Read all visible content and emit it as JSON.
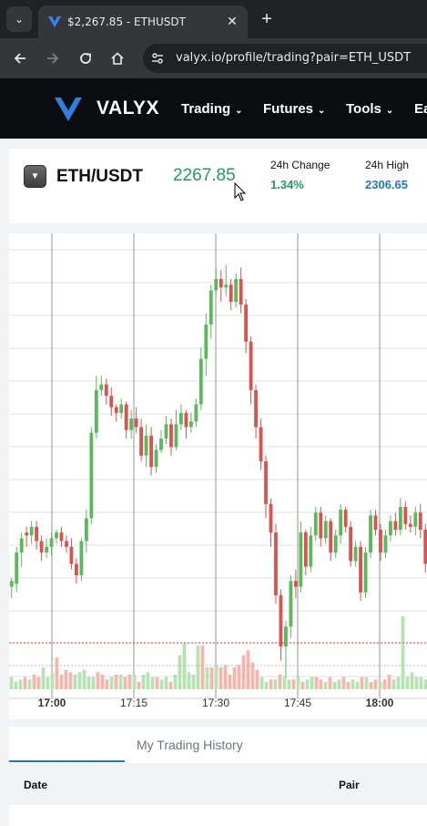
{
  "browser": {
    "tab_title": "$2,267.85 - ETHUSDT",
    "tab_close": "✕",
    "new_tab": "+",
    "tab_menu": "⌄",
    "url": "valyx.io/profile/trading?pair=ETH_USDT"
  },
  "header": {
    "brand": "VALYX",
    "nav": [
      {
        "label": "Trading"
      },
      {
        "label": "Futures"
      },
      {
        "label": "Tools"
      },
      {
        "label": "Ea"
      }
    ]
  },
  "ticker": {
    "pair": "ETH/USDT",
    "last_price": "2267.85",
    "change_label": "24h Change",
    "change_value": "1.34%",
    "high_label": "24h High",
    "high_value": "2306.65"
  },
  "colors": {
    "up": "#5cb85c",
    "down": "#d9534f",
    "up_volume": "#b7e3b4",
    "down_volume": "#f4b7ad",
    "price_green": "#1f9e5e",
    "high_blue": "#1e78c8"
  },
  "chart_data": {
    "type": "candlestick",
    "x_tick_labels": [
      "17:00",
      "17:15",
      "17:30",
      "17:45",
      "18:00"
    ],
    "candles": [
      [
        76,
        78,
        72,
        79
      ],
      [
        77,
        88,
        74,
        90
      ],
      [
        88,
        93,
        83,
        95
      ],
      [
        95,
        94,
        90,
        97
      ],
      [
        94,
        97,
        91,
        99
      ],
      [
        97,
        92,
        89,
        99
      ],
      [
        92,
        88,
        85,
        94
      ],
      [
        88,
        90,
        86,
        93
      ],
      [
        90,
        93,
        87,
        95
      ],
      [
        93,
        95,
        91,
        96
      ],
      [
        95,
        92,
        90,
        97
      ],
      [
        92,
        90,
        88,
        94
      ],
      [
        90,
        84,
        82,
        93
      ],
      [
        84,
        80,
        77,
        86
      ],
      [
        80,
        92,
        78,
        93
      ],
      [
        92,
        100,
        88,
        103
      ],
      [
        100,
        130,
        98,
        132
      ],
      [
        130,
        145,
        128,
        150
      ],
      [
        145,
        147,
        143,
        150
      ],
      [
        147,
        143,
        140,
        149
      ],
      [
        143,
        139,
        136,
        146
      ],
      [
        139,
        137,
        134,
        140
      ],
      [
        137,
        140,
        135,
        142
      ],
      [
        140,
        131,
        128,
        141
      ],
      [
        131,
        135,
        128,
        138
      ],
      [
        135,
        132,
        130,
        139
      ],
      [
        132,
        122,
        120,
        135
      ],
      [
        122,
        129,
        118,
        133
      ],
      [
        129,
        118,
        115,
        132
      ],
      [
        118,
        124,
        116,
        126
      ],
      [
        124,
        128,
        123,
        131
      ],
      [
        128,
        133,
        126,
        136
      ],
      [
        133,
        125,
        122,
        135
      ],
      [
        125,
        133,
        124,
        138
      ],
      [
        133,
        137,
        131,
        140
      ],
      [
        137,
        132,
        128,
        138
      ],
      [
        132,
        134,
        130,
        137
      ],
      [
        134,
        140,
        132,
        142
      ],
      [
        140,
        156,
        138,
        160
      ],
      [
        156,
        168,
        150,
        172
      ],
      [
        168,
        180,
        163,
        182
      ],
      [
        180,
        184,
        178,
        188
      ],
      [
        184,
        181,
        176,
        187
      ],
      [
        181,
        182,
        178,
        189
      ],
      [
        182,
        176,
        173,
        184
      ],
      [
        176,
        184,
        174,
        186
      ],
      [
        184,
        175,
        172,
        188
      ],
      [
        175,
        162,
        158,
        177
      ],
      [
        162,
        145,
        140,
        164
      ],
      [
        145,
        132,
        128,
        147
      ],
      [
        132,
        120,
        117,
        135
      ],
      [
        120,
        105,
        100,
        122
      ],
      [
        105,
        95,
        90,
        107
      ],
      [
        95,
        73,
        70,
        98
      ],
      [
        73,
        55,
        50,
        75
      ],
      [
        55,
        62,
        44,
        64
      ],
      [
        62,
        78,
        58,
        80
      ],
      [
        78,
        76,
        72,
        82
      ],
      [
        76,
        95,
        74,
        99
      ],
      [
        95,
        83,
        80,
        96
      ],
      [
        83,
        94,
        81,
        97
      ],
      [
        94,
        102,
        92,
        104
      ],
      [
        102,
        93,
        90,
        104
      ],
      [
        93,
        99,
        91,
        101
      ],
      [
        99,
        88,
        85,
        100
      ],
      [
        88,
        94,
        86,
        96
      ],
      [
        94,
        103,
        91,
        105
      ],
      [
        103,
        97,
        95,
        104
      ],
      [
        97,
        85,
        83,
        99
      ],
      [
        85,
        90,
        83,
        92
      ],
      [
        90,
        74,
        71,
        92
      ],
      [
        74,
        88,
        72,
        90
      ],
      [
        88,
        101,
        86,
        103
      ],
      [
        101,
        96,
        94,
        103
      ],
      [
        96,
        88,
        85,
        98
      ],
      [
        88,
        94,
        86,
        96
      ],
      [
        94,
        99,
        92,
        101
      ],
      [
        99,
        96,
        94,
        102
      ],
      [
        96,
        104,
        94,
        107
      ],
      [
        104,
        98,
        96,
        106
      ],
      [
        98,
        97,
        95,
        101
      ],
      [
        97,
        102,
        94,
        104
      ],
      [
        102,
        96,
        93,
        105
      ],
      [
        96,
        84,
        81,
        98
      ]
    ],
    "volume": [
      5,
      3,
      4,
      5,
      4,
      6,
      5,
      9,
      5,
      7,
      13,
      6,
      8,
      7,
      6,
      7,
      8,
      5,
      5,
      7,
      6,
      4,
      5,
      6,
      6,
      5,
      6,
      6,
      3,
      6,
      7,
      5,
      5,
      4,
      5,
      3,
      6,
      14,
      19,
      7,
      6,
      18,
      18,
      9,
      9,
      10,
      9,
      10,
      6,
      9,
      10,
      14,
      16,
      11,
      8,
      5,
      3,
      4,
      4,
      6,
      5,
      4,
      4,
      5,
      3,
      4,
      5,
      5,
      4,
      3,
      5,
      3,
      4,
      5,
      3,
      4,
      3,
      5,
      5,
      3,
      4,
      3,
      4,
      6,
      4,
      5,
      30,
      5,
      7,
      5,
      5,
      4
    ],
    "ylim": [
      40,
      200
    ],
    "grid": true
  },
  "history": {
    "tab": "My Trading History",
    "columns": [
      "Date",
      "Pair"
    ]
  }
}
